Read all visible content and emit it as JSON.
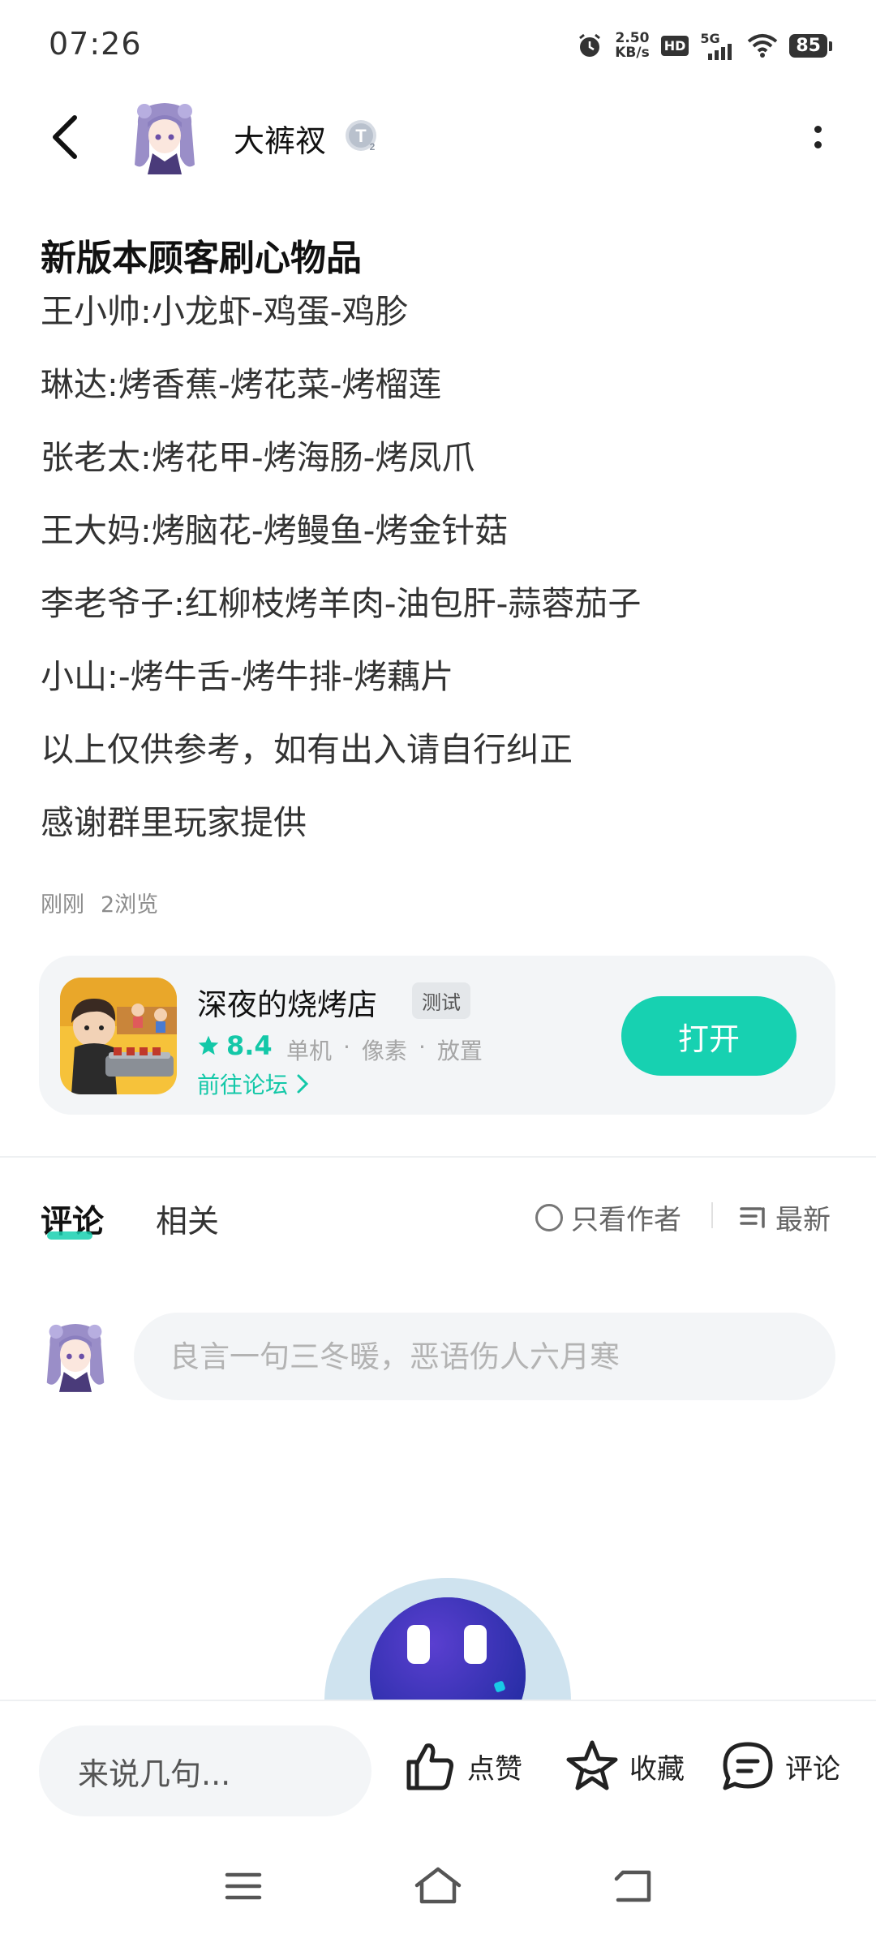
{
  "status_bar": {
    "time": "07:26",
    "speed_value": "2.50",
    "speed_unit": "KB/s",
    "hd": "HD",
    "network": "5G",
    "battery": "85"
  },
  "header": {
    "author_name": "大裤衩",
    "level_badge": "T2"
  },
  "post": {
    "title": "新版本顾客刷心物品",
    "lines": [
      "王小帅:小龙虾-鸡蛋-鸡胗",
      "琳达:烤香蕉-烤花菜-烤榴莲",
      "张老太:烤花甲-烤海肠-烤凤爪",
      "王大妈:烤脑花-烤鳗鱼-烤金针菇",
      "李老爷子:红柳枝烤羊肉-油包肝-蒜蓉茄子",
      "小山:-烤牛舌-烤牛排-烤藕片",
      "以上仅供参考，如有出入请自行纠正",
      "感谢群里玩家提供"
    ],
    "time": "刚刚",
    "views": "2浏览"
  },
  "game_card": {
    "name": "深夜的烧烤店",
    "tag": "测试",
    "rating": "8.4",
    "tags": [
      "单机",
      "·",
      "像素",
      "·",
      "放置"
    ],
    "forum_link": "前往论坛",
    "open_button": "打开"
  },
  "tabs": {
    "comments": "评论",
    "related": "相关",
    "author_only": "只看作者",
    "sort": "最新"
  },
  "comment_input": {
    "placeholder": "良言一句三冬暖，恶语伤人六月寒"
  },
  "bottom_bar": {
    "say_placeholder": "来说几句...",
    "like": "点赞",
    "favorite": "收藏",
    "comment": "评论"
  },
  "colors": {
    "accent": "#17d1b1",
    "accent_text": "#13c8a8",
    "card_bg": "#f3f5f7"
  },
  "icons": {
    "back": "back-arrow-icon",
    "more": "more-vertical-icon",
    "star": "star-icon",
    "chevron": "chevron-right-icon",
    "like": "thumbs-up-icon",
    "favorite": "star-outline-icon",
    "comment": "chat-bubble-icon",
    "sort": "sort-lines-icon"
  }
}
